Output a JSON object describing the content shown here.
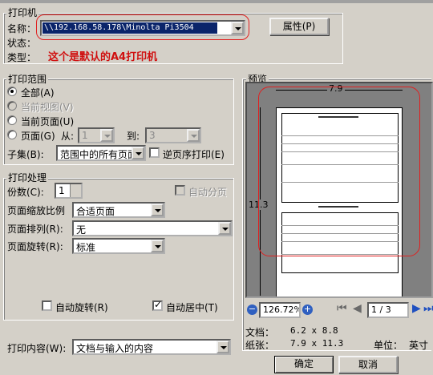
{
  "printer": {
    "group_title": "打印机",
    "name_label": "名称：",
    "status_label": "状态：",
    "type_label": "类型：",
    "name_value": "\\\\192.168.58.178\\Minolta Pi3504",
    "properties_button": "属性(P)",
    "note": "这个是默认的A4打印机"
  },
  "range": {
    "group_title": "打印范围",
    "all": "全部(A)",
    "current_view": "当前视图(V)",
    "current_page": "当前页面(U)",
    "pages": "页面(G)",
    "from_label": "从:",
    "from_value": "1",
    "to_label": "到:",
    "to_value": "3",
    "subset_label": "子集(B):",
    "subset_value": "范围中的所有页面",
    "reverse": "逆页序打印(E)"
  },
  "handling": {
    "group_title": "打印处理",
    "copies_label": "份数(C):",
    "copies_value": "1",
    "collate": "自动分页",
    "scaling_label": "页面缩放比例",
    "scaling_value": "合适页面",
    "arrange_label": "页面排列(R):",
    "arrange_value": "无",
    "rotate_label": "页面旋转(R):",
    "rotate_value": "标准",
    "auto_rotate": "自动旋转(R)",
    "auto_center": "自动居中(T)"
  },
  "print_what": {
    "label": "打印内容(W):",
    "value": "文档与输入的内容"
  },
  "preview": {
    "group_title": "预览",
    "width_dim": "7.9",
    "height_dim": "11.3",
    "zoom": "126.72%",
    "page_indicator": "1 / 3",
    "doc_label": "文档：",
    "doc_value": "6.2 x 8.8",
    "paper_label": "纸张：",
    "paper_value": "7.9 x 11.3",
    "unit_label": "单位：",
    "unit_value": "英寸"
  },
  "buttons": {
    "ok": "确定",
    "cancel": "取消"
  },
  "colors": {
    "accent_red": "#e02020",
    "selection_blue": "#0a246a"
  }
}
